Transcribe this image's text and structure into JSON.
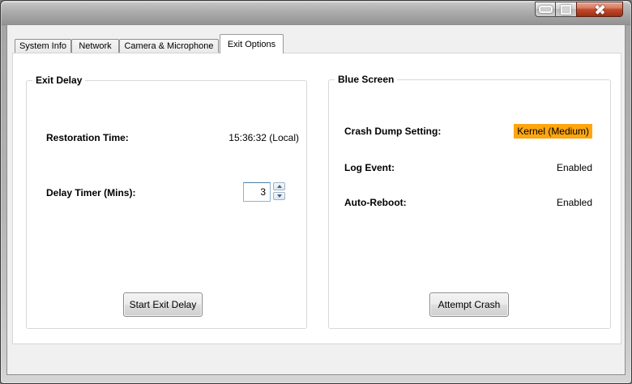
{
  "tabs": [
    {
      "label": "System Info",
      "active": false
    },
    {
      "label": "Network",
      "active": false
    },
    {
      "label": "Camera & Microphone",
      "active": false
    },
    {
      "label": "Exit Options",
      "active": true
    }
  ],
  "exit_delay": {
    "title": "Exit Delay",
    "restoration_time": {
      "label": "Restoration Time:",
      "value": "15:36:32 (Local)"
    },
    "delay_timer": {
      "label": "Delay Timer (Mins):",
      "value": "3"
    },
    "start_button": "Start Exit Delay"
  },
  "blue_screen": {
    "title": "Blue Screen",
    "crash_dump": {
      "label": "Crash Dump Setting:",
      "value": "Kernel (Medium)",
      "highlighted": true
    },
    "log_event": {
      "label": "Log Event:",
      "value": "Enabled"
    },
    "auto_reboot": {
      "label": "Auto-Reboot:",
      "value": "Enabled"
    },
    "attempt_button": "Attempt Crash"
  },
  "colors": {
    "value_highlight": "#FFA60F",
    "close_button_red": "#C4492E"
  }
}
